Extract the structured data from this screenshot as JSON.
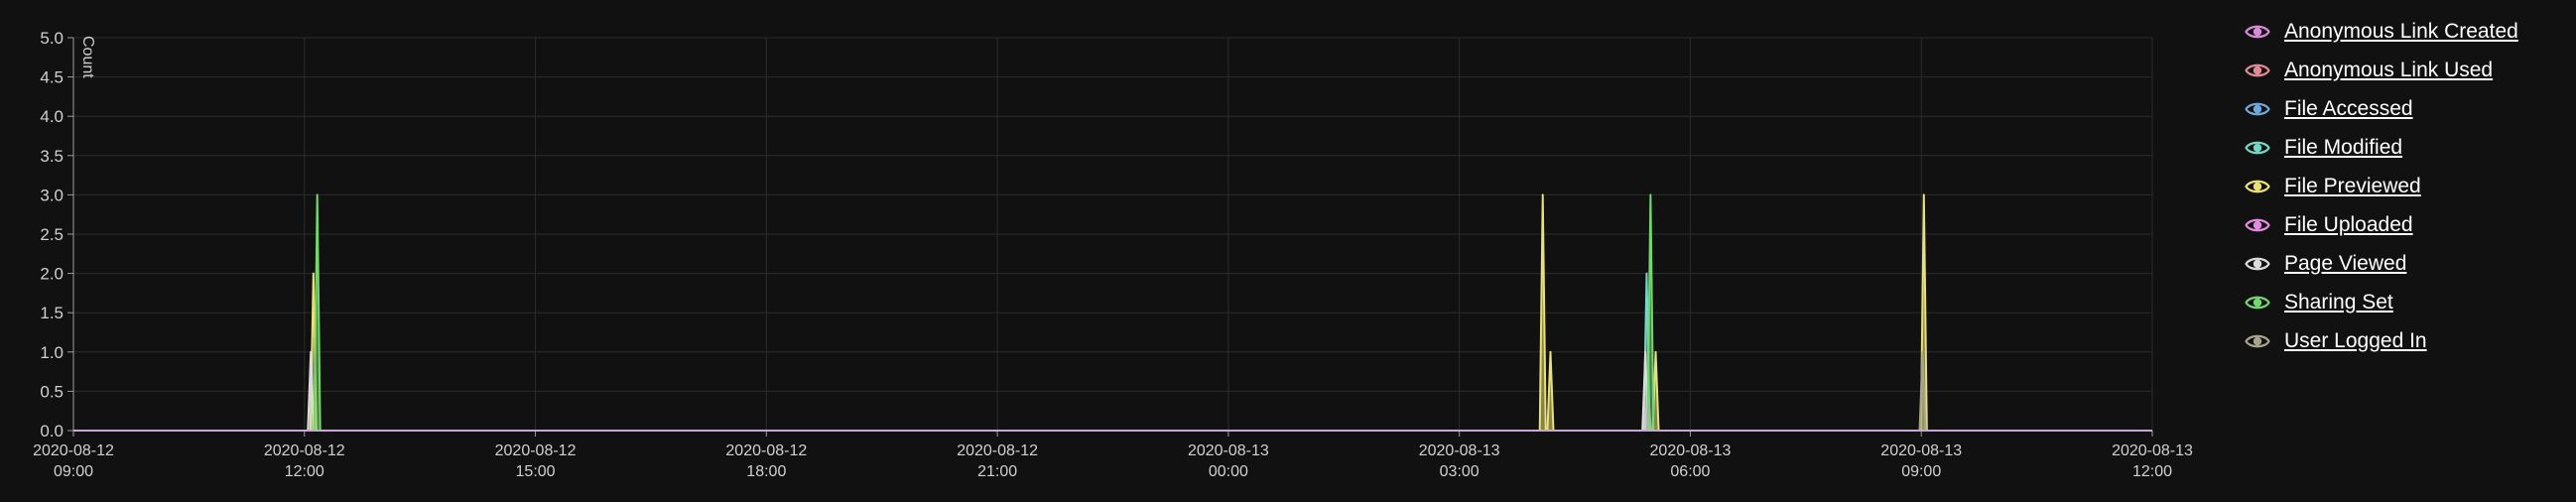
{
  "chart_data": {
    "type": "area",
    "ylabel": "Count",
    "ylim": [
      0,
      5
    ],
    "yticks": [
      "0.0",
      "0.5",
      "1.0",
      "1.5",
      "2.0",
      "2.5",
      "3.0",
      "3.5",
      "4.0",
      "4.5",
      "5.0"
    ],
    "xlim": [
      "2020-08-12 09:00",
      "2020-08-13 12:00"
    ],
    "xticks": [
      {
        "date": "2020-08-12",
        "time": "09:00"
      },
      {
        "date": "2020-08-12",
        "time": "12:00"
      },
      {
        "date": "2020-08-12",
        "time": "15:00"
      },
      {
        "date": "2020-08-12",
        "time": "18:00"
      },
      {
        "date": "2020-08-12",
        "time": "21:00"
      },
      {
        "date": "2020-08-13",
        "time": "00:00"
      },
      {
        "date": "2020-08-13",
        "time": "03:00"
      },
      {
        "date": "2020-08-13",
        "time": "06:00"
      },
      {
        "date": "2020-08-13",
        "time": "09:00"
      },
      {
        "date": "2020-08-13",
        "time": "12:00"
      }
    ],
    "grid": true,
    "legend_position": "right",
    "series": [
      {
        "name": "Anonymous Link Created",
        "color": "#d98ad9",
        "points": []
      },
      {
        "name": "Anonymous Link Used",
        "color": "#e08a95",
        "points": []
      },
      {
        "name": "File Accessed",
        "color": "#6fa8dc",
        "points": []
      },
      {
        "name": "File Modified",
        "color": "#76d7c4",
        "points": [
          {
            "x": "2020-08-13 05:26",
            "y": 2
          }
        ]
      },
      {
        "name": "File Previewed",
        "color": "#e8e07a",
        "points": [
          {
            "x": "2020-08-12 12:07",
            "y": 2
          },
          {
            "x": "2020-08-13 04:05",
            "y": 3
          },
          {
            "x": "2020-08-13 04:11",
            "y": 1
          },
          {
            "x": "2020-08-13 05:33",
            "y": 1
          },
          {
            "x": "2020-08-13 09:02",
            "y": 3
          }
        ]
      },
      {
        "name": "File Uploaded",
        "color": "#e38be3",
        "points": [
          {
            "x": "2020-08-13 05:27",
            "y": 0.5
          }
        ]
      },
      {
        "name": "Page Viewed",
        "color": "#dcdcdc",
        "points": [
          {
            "x": "2020-08-12 12:05",
            "y": 1
          },
          {
            "x": "2020-08-13 05:25",
            "y": 1
          }
        ]
      },
      {
        "name": "Sharing Set",
        "color": "#74d66e",
        "points": [
          {
            "x": "2020-08-12 12:10",
            "y": 3
          },
          {
            "x": "2020-08-13 05:29",
            "y": 3
          }
        ]
      },
      {
        "name": "User Logged In",
        "color": "#a6a48a",
        "points": [
          {
            "x": "2020-08-13 09:01",
            "y": 1
          }
        ]
      }
    ]
  }
}
